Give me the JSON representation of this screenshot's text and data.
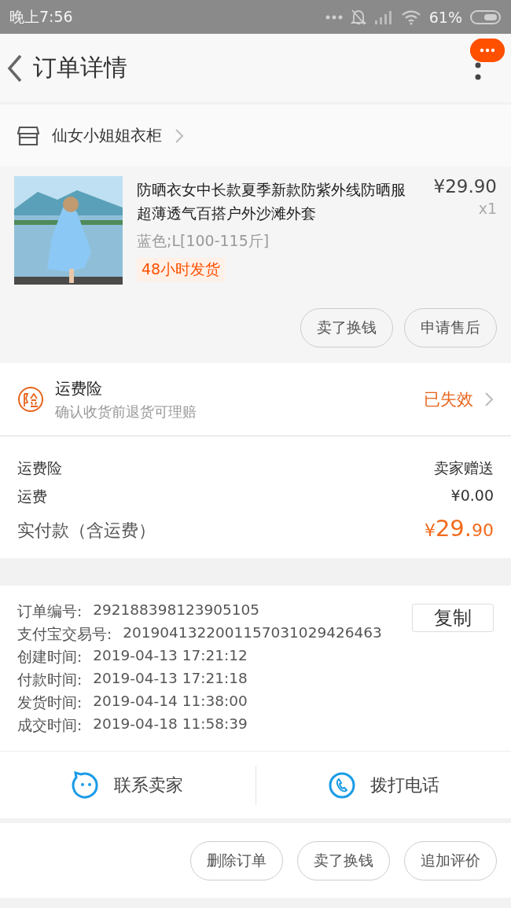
{
  "status_bar": {
    "time": "晚上7:56",
    "battery": "61%"
  },
  "header": {
    "title": "订单详情"
  },
  "shop": {
    "name": "仙女小姐姐衣柜"
  },
  "product": {
    "image": {
      "kind": "picture"
    },
    "title": "防晒衣女中长款夏季新款防紫外线防晒服超薄透气百搭户外沙滩外套",
    "price": "¥29.90",
    "quantity": "x1",
    "spec": "蓝色;L[100-115斤]",
    "tag": "48小时发货",
    "actions": [
      "卖了换钱",
      "申请售后"
    ]
  },
  "insurance": {
    "title": "运费险",
    "subtitle": "确认收货前退货可理赔",
    "status": "已失效"
  },
  "fees": [
    {
      "label": "运费险",
      "value": "卖家赠送"
    },
    {
      "label": "运费",
      "value": "¥0.00"
    }
  ],
  "total": {
    "label": "实付款（含运费）",
    "currency": "¥",
    "integer": "29.",
    "decimal": "90"
  },
  "order_info": {
    "copy_button": "复制",
    "rows": [
      {
        "label": "订单编号:",
        "value": "292188398123905105"
      },
      {
        "label": "支付宝交易号:",
        "value": "2019041322001157031029426463"
      },
      {
        "label": "创建时间:",
        "value": "2019-04-13 17:21:12"
      },
      {
        "label": "付款时间:",
        "value": "2019-04-13 17:21:18"
      },
      {
        "label": "发货时间:",
        "value": "2019-04-14 11:38:00"
      },
      {
        "label": "成交时间:",
        "value": "2019-04-18 11:58:39"
      }
    ]
  },
  "contact": [
    {
      "kind": "chat",
      "label": "联系卖家"
    },
    {
      "kind": "phone",
      "label": "拨打电话"
    }
  ],
  "bottom_actions": [
    "删除订单",
    "卖了换钱",
    "追加评价"
  ]
}
